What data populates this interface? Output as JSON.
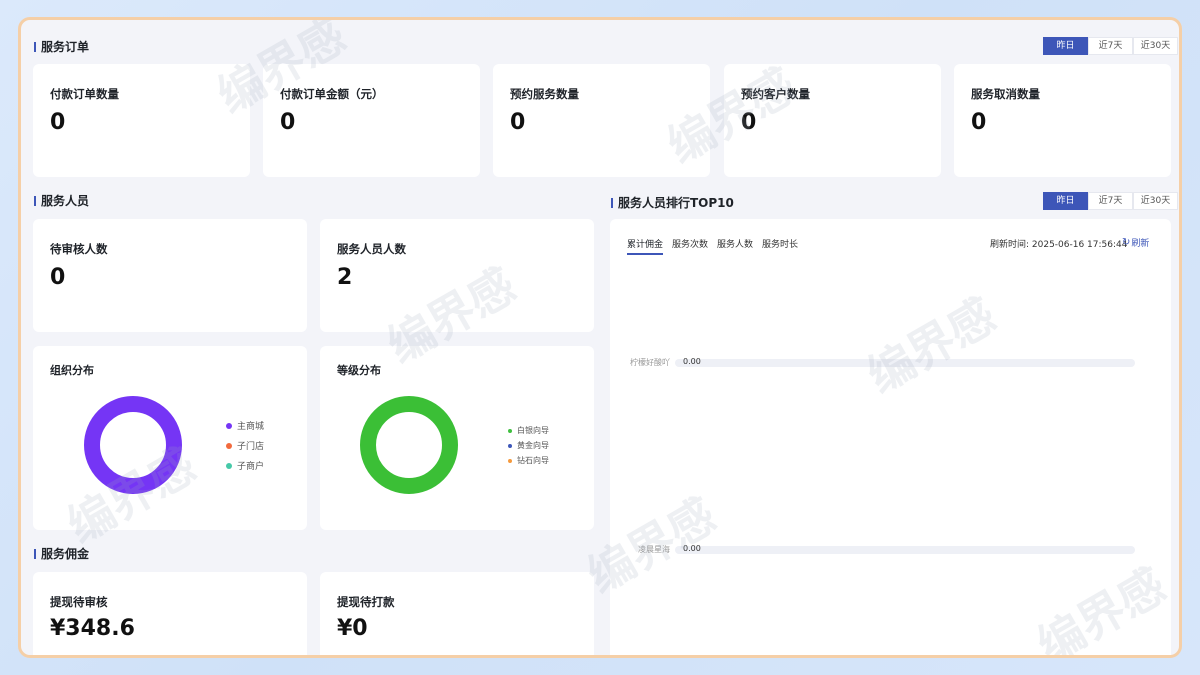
{
  "orders": {
    "title": "服务订单",
    "periods": [
      "昨日",
      "近7天",
      "近30天"
    ],
    "stats": [
      {
        "label": "付款订单数量",
        "value": "0"
      },
      {
        "label": "付款订单金额（元）",
        "value": "0"
      },
      {
        "label": "预约服务数量",
        "value": "0"
      },
      {
        "label": "预约客户数量",
        "value": "0"
      },
      {
        "label": "服务取消数量",
        "value": "0"
      }
    ]
  },
  "staff": {
    "title": "服务人员",
    "stats": [
      {
        "label": "待审核人数",
        "value": "0"
      },
      {
        "label": "服务人员人数",
        "value": "2"
      }
    ],
    "org": {
      "title": "组织分布",
      "legend": [
        {
          "label": "主商城",
          "color": "#7535f5"
        },
        {
          "label": "子门店",
          "color": "#f26a3d"
        },
        {
          "label": "子商户",
          "color": "#46c9a8"
        }
      ],
      "ring_color": "#7535f5"
    },
    "level": {
      "title": "等级分布",
      "legend": [
        {
          "label": "白银向导",
          "color": "#3fbf3f"
        },
        {
          "label": "黄金向导",
          "color": "#3d56b8"
        },
        {
          "label": "钻石向导",
          "color": "#f59a3d"
        }
      ],
      "ring_color": "#3bbf36"
    }
  },
  "commission": {
    "title": "服务佣金",
    "stats": [
      {
        "label": "提现待审核",
        "value": "¥348.6"
      },
      {
        "label": "提现待打款",
        "value": "¥0"
      }
    ]
  },
  "ranking": {
    "title": "服务人员排行TOP10",
    "periods": [
      "昨日",
      "近7天",
      "近30天"
    ],
    "tabs": [
      "累计佣金",
      "服务次数",
      "服务人数",
      "服务时长"
    ],
    "refresh_time": "刷新时间: 2025-06-16 17:56:44",
    "refresh_label": "刷新",
    "rows": [
      {
        "name": "柠檬好酸吖",
        "value": "0.00"
      },
      {
        "name": "凌晨星海",
        "value": "0.00"
      }
    ]
  },
  "colors": {
    "accent": "#3d56b8",
    "frame_border": "#f5cfa7"
  },
  "watermark_text": "编界感"
}
